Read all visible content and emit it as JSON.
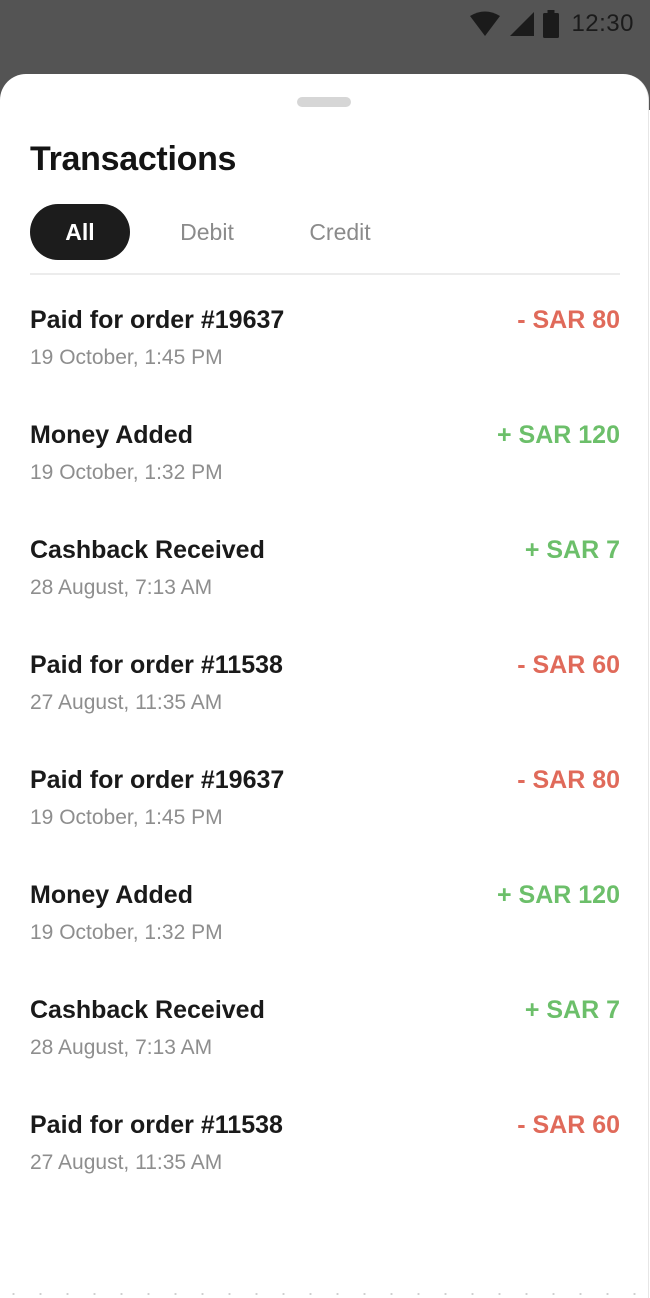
{
  "status_bar": {
    "time": "12:30",
    "icons": [
      "wifi-icon",
      "signal-icon",
      "battery-icon"
    ]
  },
  "sheet": {
    "title": "Transactions",
    "tabs": [
      {
        "label": "All",
        "selected": true
      },
      {
        "label": "Debit",
        "selected": false
      },
      {
        "label": "Credit",
        "selected": false
      }
    ],
    "transactions": [
      {
        "title": "Paid for order #19637",
        "date": "19 October, 1:45 PM",
        "amount": "- SAR 80",
        "type": "debit"
      },
      {
        "title": "Money Added",
        "date": "19 October, 1:32 PM",
        "amount": "+ SAR 120",
        "type": "credit"
      },
      {
        "title": "Cashback Received",
        "date": "28 August, 7:13 AM",
        "amount": "+ SAR 7",
        "type": "credit"
      },
      {
        "title": "Paid for order #11538",
        "date": "27 August, 11:35 AM",
        "amount": "- SAR 60",
        "type": "debit"
      },
      {
        "title": "Paid for order #19637",
        "date": "19 October, 1:45 PM",
        "amount": "- SAR 80",
        "type": "debit"
      },
      {
        "title": "Money Added",
        "date": "19 October, 1:32 PM",
        "amount": "+ SAR 120",
        "type": "credit"
      },
      {
        "title": "Cashback Received",
        "date": "28 August, 7:13 AM",
        "amount": "+ SAR 7",
        "type": "credit"
      },
      {
        "title": "Paid for order #11538",
        "date": "27 August, 11:35 AM",
        "amount": "- SAR 60",
        "type": "debit"
      }
    ]
  },
  "colors": {
    "status_bar_bg": "#545454",
    "tab_selected_bg": "#1c1c1c",
    "debit": "#e06a5a",
    "credit": "#6cbf6a",
    "title_text": "#141414",
    "secondary_text": "#8e8e8e"
  }
}
